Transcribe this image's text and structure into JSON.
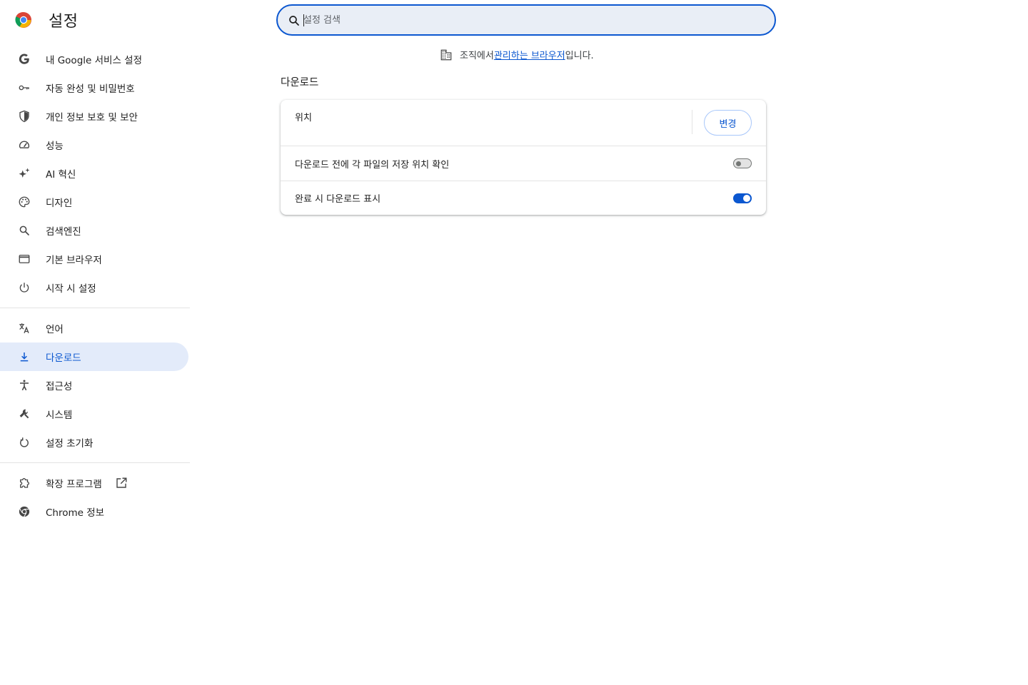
{
  "header": {
    "title": "설정",
    "search_placeholder": "설정 검색"
  },
  "sidebar": {
    "group1": [
      {
        "label": "내 Google 서비스 설정",
        "icon": "google-g-icon"
      },
      {
        "label": "자동 완성 및 비밀번호",
        "icon": "key-icon"
      },
      {
        "label": "개인 정보 보호 및 보안",
        "icon": "shield-icon"
      },
      {
        "label": "성능",
        "icon": "speedometer-icon"
      },
      {
        "label": "AI 혁신",
        "icon": "sparkle-icon"
      },
      {
        "label": "디자인",
        "icon": "palette-icon"
      },
      {
        "label": "검색엔진",
        "icon": "search-icon"
      },
      {
        "label": "기본 브라우저",
        "icon": "browser-window-icon"
      },
      {
        "label": "시작 시 설정",
        "icon": "power-icon"
      }
    ],
    "group2": [
      {
        "label": "언어",
        "icon": "translate-icon"
      },
      {
        "label": "다운로드",
        "icon": "download-icon",
        "active": true
      },
      {
        "label": "접근성",
        "icon": "accessibility-icon"
      },
      {
        "label": "시스템",
        "icon": "wrench-icon"
      },
      {
        "label": "설정 초기화",
        "icon": "reset-icon"
      }
    ],
    "group3": [
      {
        "label": "확장 프로그램",
        "icon": "extension-icon"
      },
      {
        "label": "Chrome 정보",
        "icon": "chrome-icon"
      }
    ]
  },
  "managed_notice": {
    "prefix": "조직에서 ",
    "link": "관리하는 브라우저",
    "suffix": "입니다."
  },
  "downloads": {
    "section_title": "다운로드",
    "location_label": "위치",
    "change_button": "변경",
    "ask_location_label": "다운로드 전에 각 파일의 저장 위치 확인",
    "ask_location_enabled": false,
    "show_when_done_label": "완료 시 다운로드 표시",
    "show_when_done_enabled": true
  },
  "colors": {
    "accent": "#0b57d0",
    "active_nav_bg": "#e3ebfa",
    "search_bg": "#e9eef6"
  }
}
